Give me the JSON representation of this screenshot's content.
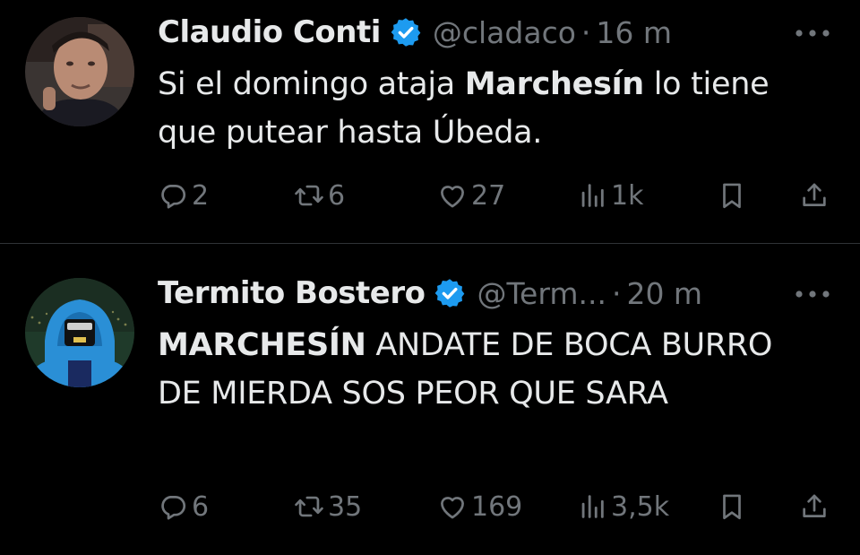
{
  "colors": {
    "background": "#000000",
    "primary_text": "#e7e9ea",
    "secondary_text": "#71767b",
    "verified_badge": "#1d9bf0",
    "divider": "#2f3336"
  },
  "tweets": [
    {
      "display_name": "Claudio Conti",
      "verified": true,
      "handle": "@cladaco",
      "separator": "·",
      "timestamp": "16 m",
      "text_parts": [
        "Si el domingo ataja ",
        "Marchesín",
        " lo tiene que putear hasta Úbeda."
      ],
      "stats": {
        "replies": "2",
        "retweets": "6",
        "likes": "27",
        "views": "1k"
      },
      "icons": [
        "reply-icon",
        "retweet-icon",
        "like-icon",
        "views-icon",
        "bookmark-icon",
        "share-icon",
        "more-icon"
      ]
    },
    {
      "display_name": "Termito Bostero",
      "verified": true,
      "handle": "@Term...",
      "separator": "·",
      "timestamp": "20 m",
      "text_parts": [
        "MARCHESÍN",
        " ANDATE DE BOCA BURRO DE MIERDA SOS PEOR QUE SARA"
      ],
      "stats": {
        "replies": "6",
        "retweets": "35",
        "likes": "169",
        "views": "3,5k"
      },
      "icons": [
        "reply-icon",
        "retweet-icon",
        "like-icon",
        "views-icon",
        "bookmark-icon",
        "share-icon",
        "more-icon"
      ]
    }
  ]
}
